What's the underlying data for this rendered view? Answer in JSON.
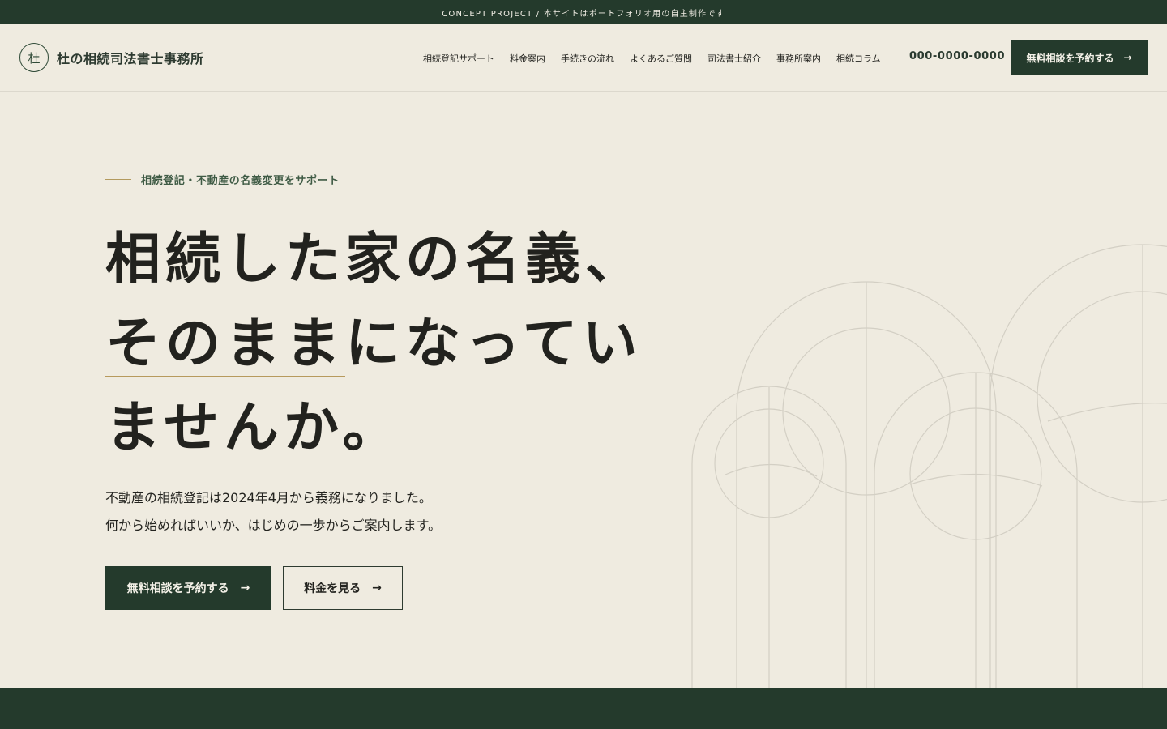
{
  "topbar": {
    "text": "CONCEPT PROJECT / 本サイトはポートフォリオ用の自主制作です"
  },
  "header": {
    "logo_mark": "杜",
    "logo_text": "杜の相続司法書士事務所",
    "nav": [
      "相続登記サポート",
      "料金案内",
      "手続きの流れ",
      "よくあるご質問",
      "司法書士紹介",
      "事務所案内",
      "相続コラム"
    ],
    "phone": "000-0000-0000",
    "cta_label": "無料相談を予約する",
    "cta_arrow": "→"
  },
  "hero": {
    "eyebrow": "相続登記・不動産の名義変更をサポート",
    "headline_line1": "相続した家の名義、",
    "headline_line2_underlined": "そのまま",
    "headline_line2_rest": "になってい",
    "headline_line3": "ませんか。",
    "lead_line1": "不動産の相続登記は2024年4月から義務になりました。",
    "lead_line2": "何から始めればいいか、はじめの一歩からご案内します。",
    "primary_label": "無料相談を予約する",
    "primary_arrow": "→",
    "secondary_label": "料金を見る",
    "secondary_arrow": "→"
  },
  "colors": {
    "background": "#efebe0",
    "brand_green": "#243a2c",
    "accent_gold": "#b79a5d",
    "text": "#23231f"
  }
}
